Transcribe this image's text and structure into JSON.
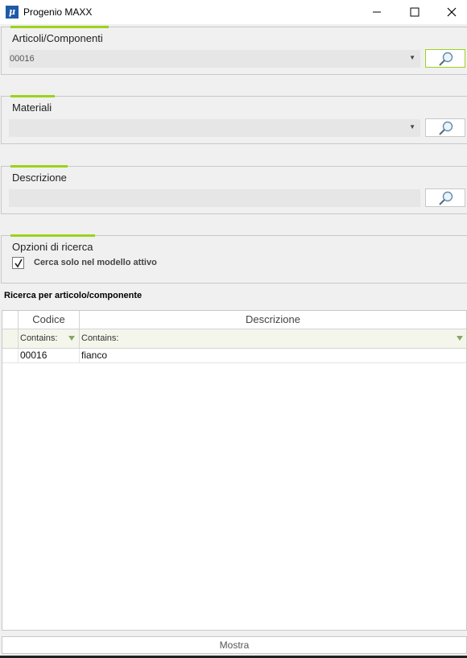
{
  "window": {
    "title": "Progenio MAXX",
    "icon": "progenio-logo-icon"
  },
  "articoli": {
    "label": "Articoli/Componenti",
    "value": "00016"
  },
  "materiali": {
    "label": "Materiali",
    "value": ""
  },
  "descrizione": {
    "label": "Descrizione",
    "value": ""
  },
  "opzioni": {
    "label": "Opzioni di ricerca",
    "checkbox_label": "Cerca solo nel modello attivo",
    "checked": true
  },
  "results": {
    "title": "Ricerca per articolo/componente",
    "columns": [
      "Codice",
      "Descrizione"
    ],
    "filters": [
      "Contains:",
      "Contains:"
    ],
    "rows": [
      {
        "codice": "00016",
        "descrizione": "fianco"
      }
    ]
  },
  "footer": {
    "button_label": "Mostra"
  },
  "colors": {
    "accent": "#9cd21c",
    "app_icon": "#1f5aa6",
    "filter_bg": "#f4f6ec"
  }
}
